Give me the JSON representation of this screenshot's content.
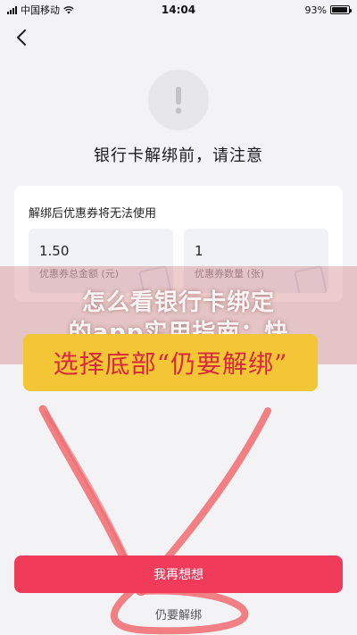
{
  "status_bar": {
    "carrier": "中国移动",
    "time": "14:04",
    "battery": "93%",
    "battery_level": 0.93
  },
  "header": {
    "back_icon": "chevron-left-icon"
  },
  "dialog": {
    "icon": "exclamation-icon",
    "title": "银行卡解绑前，请注意"
  },
  "card": {
    "title": "解绑后优惠券将无法使用",
    "stats": [
      {
        "value": "1.50",
        "label": "优惠券总金额 (元)"
      },
      {
        "value": "1",
        "label": "优惠券数量 (张)"
      }
    ]
  },
  "overlay": {
    "line1": "怎么看银行卡绑定",
    "line2": "的app实用指南：快",
    "callout": "选择底部“仍要解绑”"
  },
  "actions": {
    "primary_label": "我再想想",
    "secondary_label": "仍要解绑"
  },
  "colors": {
    "accent": "#f03b5a",
    "callout_bg": "#f2c634",
    "callout_text": "#d8283c",
    "arrow": "#f06a70"
  }
}
